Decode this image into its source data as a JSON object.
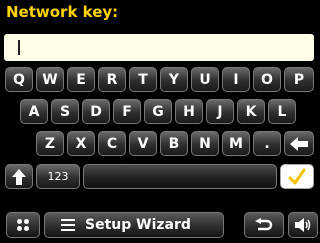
{
  "header": {
    "title": "Network key:"
  },
  "input": {
    "value": ""
  },
  "keyboard": {
    "row1": [
      "Q",
      "W",
      "E",
      "R",
      "T",
      "Y",
      "U",
      "I",
      "O",
      "P"
    ],
    "row2": [
      "A",
      "S",
      "D",
      "F",
      "G",
      "H",
      "J",
      "K",
      "L"
    ],
    "row3": [
      "Z",
      "X",
      "C",
      "V",
      "B",
      "N",
      "M",
      "."
    ],
    "numeric_label": "123"
  },
  "bottom_bar": {
    "title": "Setup Wizard"
  }
}
